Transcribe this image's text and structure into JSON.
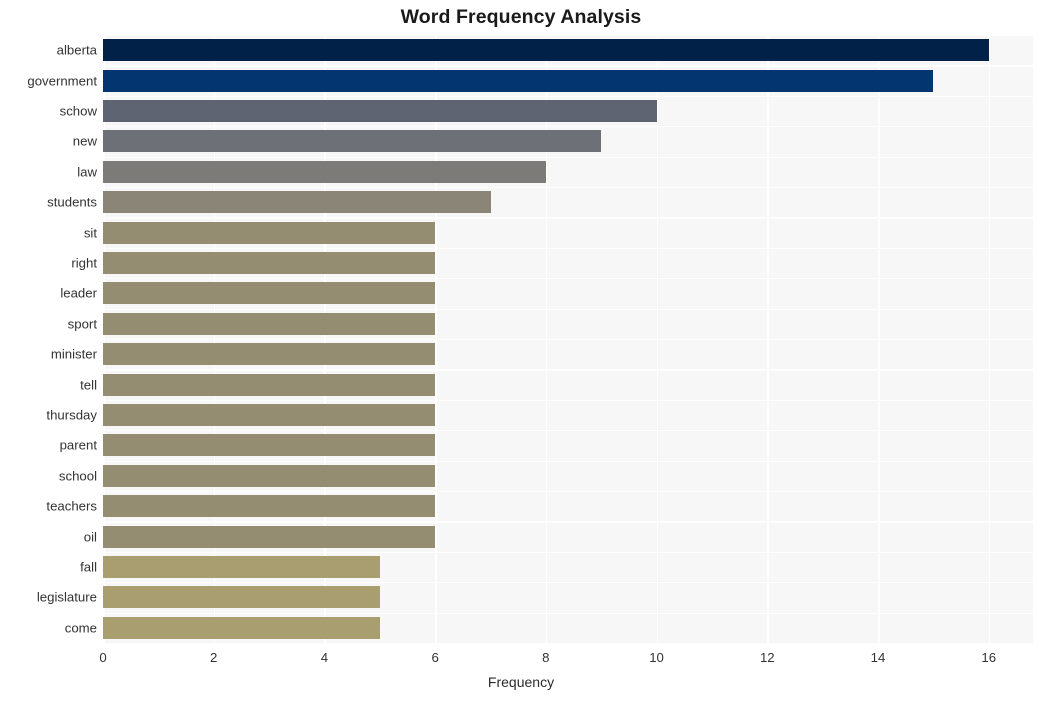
{
  "chart_data": {
    "type": "bar",
    "orientation": "horizontal",
    "title": "Word Frequency Analysis",
    "xlabel": "Frequency",
    "ylabel": "",
    "xlim": [
      0,
      16.8
    ],
    "ylim": null,
    "grid": true,
    "legend": null,
    "xticks": [
      0,
      2,
      4,
      6,
      8,
      10,
      12,
      14,
      16
    ],
    "xtick_labels": [
      "0",
      "2",
      "4",
      "6",
      "8",
      "10",
      "12",
      "14",
      "16"
    ],
    "categories": [
      "alberta",
      "government",
      "schow",
      "new",
      "law",
      "students",
      "sit",
      "right",
      "leader",
      "sport",
      "minister",
      "tell",
      "thursday",
      "parent",
      "school",
      "teachers",
      "oil",
      "fall",
      "legislature",
      "come"
    ],
    "values": [
      16,
      15,
      10,
      9,
      8,
      7,
      6,
      6,
      6,
      6,
      6,
      6,
      6,
      6,
      6,
      6,
      6,
      5,
      5,
      5
    ],
    "bar_colors": [
      "#022148",
      "#033570",
      "#5e6472",
      "#6d7076",
      "#7d7b77",
      "#8a8576",
      "#948d72",
      "#948d72",
      "#948d72",
      "#948d72",
      "#948d72",
      "#948d72",
      "#948d72",
      "#948d72",
      "#948d72",
      "#948d72",
      "#948d72",
      "#a89e70",
      "#a89e70",
      "#a89e70"
    ],
    "plot_background": "#f7f7f7",
    "grid_color": "#ffffff",
    "page_background": "#ffffff",
    "text_color": "#333333"
  }
}
